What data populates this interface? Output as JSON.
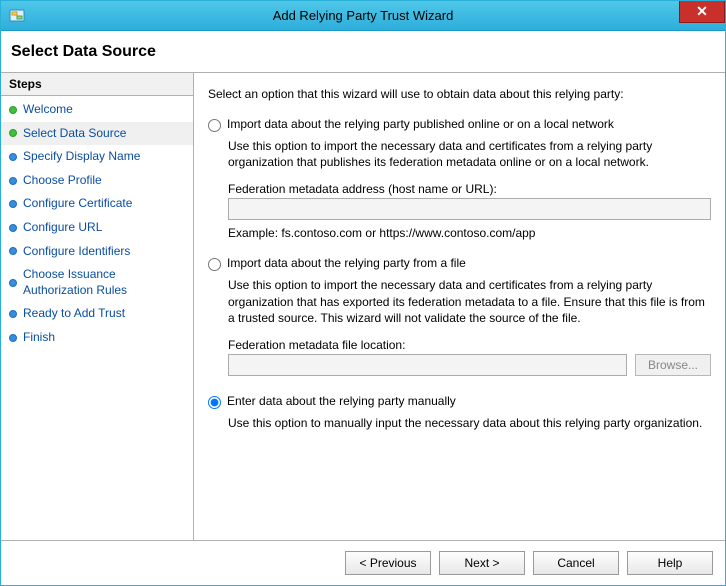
{
  "titlebar": {
    "title": "Add Relying Party Trust Wizard",
    "close_symbol": "✕"
  },
  "subheader": {
    "title": "Select Data Source"
  },
  "sidebar": {
    "header": "Steps",
    "items": [
      {
        "label": "Welcome",
        "bullet": "done"
      },
      {
        "label": "Select Data Source",
        "bullet": "done",
        "current": true
      },
      {
        "label": "Specify Display Name",
        "bullet": "todo"
      },
      {
        "label": "Choose Profile",
        "bullet": "todo"
      },
      {
        "label": "Configure Certificate",
        "bullet": "todo"
      },
      {
        "label": "Configure URL",
        "bullet": "todo"
      },
      {
        "label": "Configure Identifiers",
        "bullet": "todo"
      },
      {
        "label": "Choose Issuance Authorization Rules",
        "bullet": "todo"
      },
      {
        "label": "Ready to Add Trust",
        "bullet": "todo"
      },
      {
        "label": "Finish",
        "bullet": "todo"
      }
    ]
  },
  "main": {
    "intro": "Select an option that this wizard will use to obtain data about this relying party:",
    "option1": {
      "label": "Import data about the relying party published online or on a local network",
      "desc": "Use this option to import the necessary data and certificates from a relying party organization that publishes its federation metadata online or on a local network.",
      "field_label": "Federation metadata address (host name or URL):",
      "field_value": "",
      "example": "Example: fs.contoso.com or https://www.contoso.com/app"
    },
    "option2": {
      "label": "Import data about the relying party from a file",
      "desc": "Use this option to import the necessary data and certificates from a relying party organization that has exported its federation metadata to a file. Ensure that this file is from a trusted source.   This wizard will not validate the source of the file.",
      "field_label": "Federation metadata file location:",
      "field_value": "",
      "browse_label": "Browse..."
    },
    "option3": {
      "label": "Enter data about the relying party manually",
      "desc": "Use this option to manually input the necessary data about this relying party organization."
    },
    "selected_option": 3
  },
  "footer": {
    "previous": "< Previous",
    "next": "Next >",
    "cancel": "Cancel",
    "help": "Help"
  }
}
